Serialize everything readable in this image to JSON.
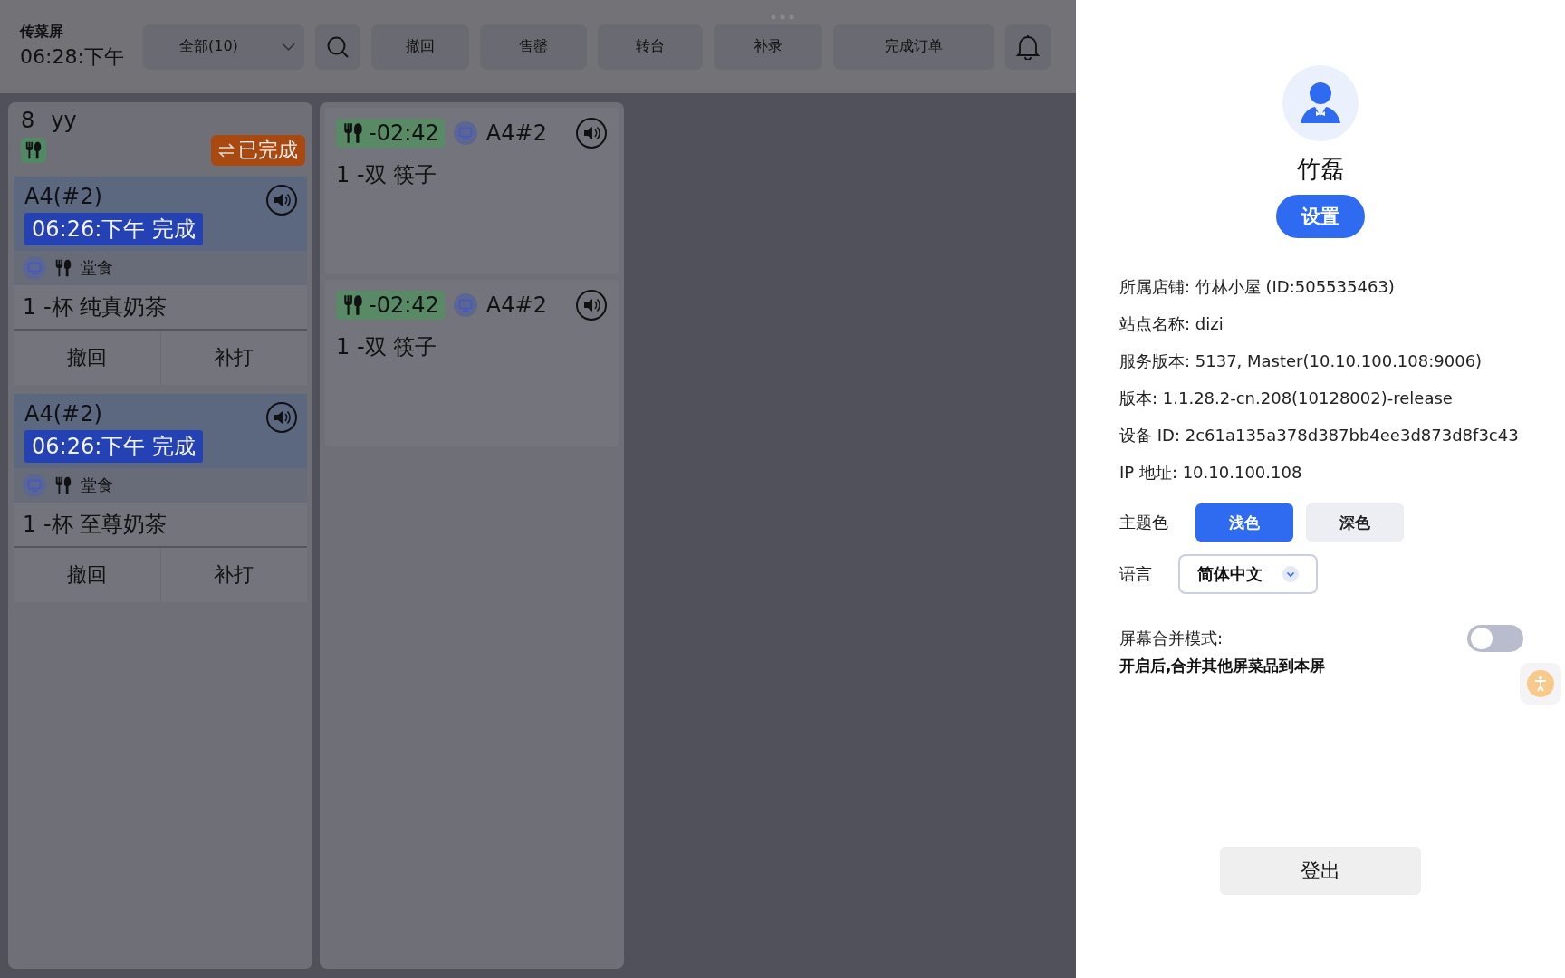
{
  "header": {
    "title": "传菜屏",
    "time": "06:28:下午"
  },
  "filter": {
    "value": "全部(10)"
  },
  "toolbar": [
    "撤回",
    "售罄",
    "转台",
    "补录",
    "完成订单"
  ],
  "order_group": {
    "number": "8",
    "name": "yy",
    "status": "已完成",
    "orders": [
      {
        "table": "A4(#2)",
        "time_status": "06:26:下午 完成",
        "type": "堂食",
        "item": "1 -杯 纯真奶茶",
        "actions": [
          "撤回",
          "补打"
        ]
      },
      {
        "table": "A4(#2)",
        "time_status": "06:26:下午 完成",
        "type": "堂食",
        "item": "1 -杯 至尊奶茶",
        "actions": [
          "撤回",
          "补打"
        ]
      }
    ]
  },
  "tickets": [
    {
      "timer": "-02:42",
      "table": "A4#2",
      "item": "1 -双 筷子"
    },
    {
      "timer": "-02:42",
      "table": "A4#2",
      "item": "1 -双 筷子"
    }
  ],
  "profile": {
    "name": "竹磊",
    "settings_button": "设置",
    "info": [
      "所属店铺: 竹林小屋 (ID:505535463)",
      "站点名称: dizi",
      "服务版本: 5137, Master(10.10.100.108:9006)",
      "版本: 1.1.28.2-cn.208(10128002)-release",
      "设备 ID: 2c61a135a378d387bb4ee3d873d8f3c43",
      "IP 地址: 10.10.100.108"
    ],
    "theme": {
      "label": "主题色",
      "options": [
        {
          "label": "浅色",
          "selected": true
        },
        {
          "label": "深色",
          "selected": false
        }
      ]
    },
    "language": {
      "label": "语言",
      "value": "简体中文"
    },
    "merge_mode": {
      "label": "屏幕合并模式:",
      "on": false,
      "hint": "开启后,合并其他屏菜品到本屏"
    },
    "logout": "登出"
  }
}
